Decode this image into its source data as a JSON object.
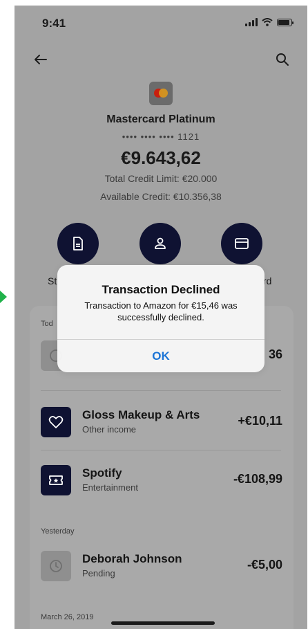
{
  "status_bar": {
    "time": "9:41"
  },
  "card": {
    "name": "Mastercard Platinum",
    "number_masked": "•••• •••• •••• 1121",
    "balance": "€9.643,62",
    "total_credit": "Total Credit Limit: €20.000",
    "available_credit": "Available Credit: €10.356,38"
  },
  "actions": {
    "left_label_partial": "St",
    "right_label_partial": "rd"
  },
  "transactions": {
    "today_label": "Tod",
    "rows": [
      {
        "title": "",
        "subtitle": "",
        "amount": "36"
      },
      {
        "title": "Gloss Makeup & Arts",
        "subtitle": "Other income",
        "amount": "+€10,11"
      },
      {
        "title": "Spotify",
        "subtitle": "Entertainment",
        "amount": "-€108,99"
      }
    ],
    "yesterday_label": "Yesterday",
    "yesterday_rows": [
      {
        "title": "Deborah Johnson",
        "subtitle": "Pending",
        "amount": "-€5,00"
      }
    ],
    "next_section_label": "March 26, 2019"
  },
  "alert": {
    "title": "Transaction Declined",
    "message": "Transaction to Amazon for €15,46 was successfully declined.",
    "ok_label": "OK"
  },
  "colors": {
    "overlay_bg": "#a3a3a3",
    "icon_dark": "#0f1232",
    "alert_link": "#1b74d6",
    "side_arrow": "#20b24a"
  },
  "icons": [
    "back-arrow-icon",
    "search-icon",
    "mastercard-logo",
    "statement-icon",
    "user-icon",
    "card-icon",
    "clock-icon",
    "heart-icon",
    "ticket-icon"
  ]
}
